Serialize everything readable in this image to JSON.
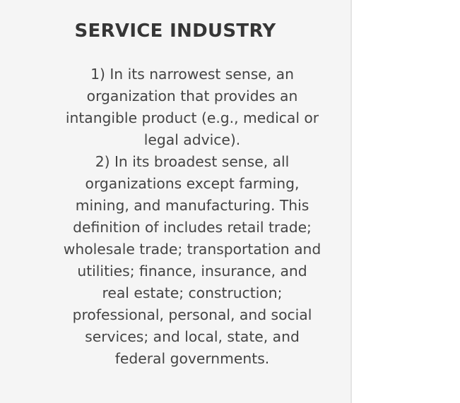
{
  "entry": {
    "title": "SERVICE INDUSTRY",
    "definitions": [
      "1) In its narrowest sense, an organization that provides an intangible product (e.g., medical or legal advice).",
      "2) In its broadest sense, all organizations except farming, mining, and manufacturing. This definition of includes retail trade; wholesale trade; transportation and utilities; finance, insurance, and real estate; construction; professional, personal, and social services; and local, state, and federal governments."
    ]
  },
  "colors": {
    "card_background": "#f5f5f5",
    "title_text": "#363636",
    "body_text": "#444444",
    "page_background": "#ffffff"
  }
}
